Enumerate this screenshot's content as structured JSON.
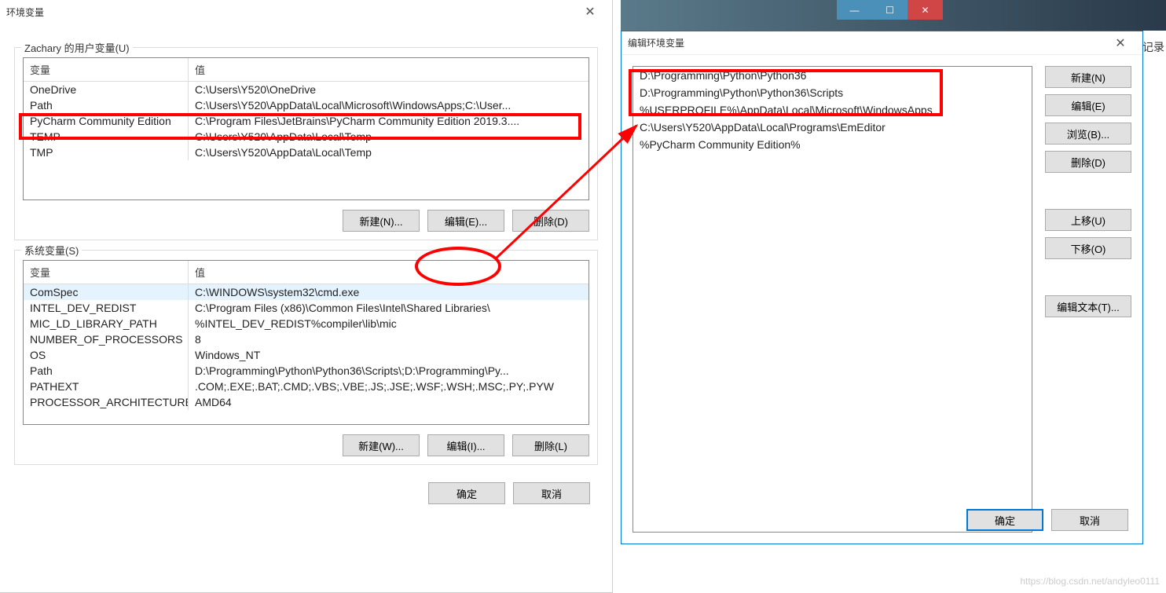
{
  "envDialog": {
    "title": "环境变量",
    "close": "✕",
    "userGroup": {
      "label": "Zachary 的用户变量(U)",
      "headers": {
        "name": "变量",
        "value": "值"
      },
      "rows": [
        {
          "name": "OneDrive",
          "value": "C:\\Users\\Y520\\OneDrive"
        },
        {
          "name": "Path",
          "value": "C:\\Users\\Y520\\AppData\\Local\\Microsoft\\WindowsApps;C:\\User..."
        },
        {
          "name": "PyCharm Community Edition",
          "value": "C:\\Program Files\\JetBrains\\PyCharm Community Edition 2019.3...."
        },
        {
          "name": "TEMP",
          "value": "C:\\Users\\Y520\\AppData\\Local\\Temp"
        },
        {
          "name": "TMP",
          "value": "C:\\Users\\Y520\\AppData\\Local\\Temp"
        }
      ],
      "buttons": {
        "new": "新建(N)...",
        "edit": "编辑(E)...",
        "delete": "删除(D)"
      }
    },
    "sysGroup": {
      "label": "系统变量(S)",
      "headers": {
        "name": "变量",
        "value": "值"
      },
      "rows": [
        {
          "name": "ComSpec",
          "value": "C:\\WINDOWS\\system32\\cmd.exe"
        },
        {
          "name": "INTEL_DEV_REDIST",
          "value": "C:\\Program Files (x86)\\Common Files\\Intel\\Shared Libraries\\"
        },
        {
          "name": "MIC_LD_LIBRARY_PATH",
          "value": "%INTEL_DEV_REDIST%compiler\\lib\\mic"
        },
        {
          "name": "NUMBER_OF_PROCESSORS",
          "value": "8"
        },
        {
          "name": "OS",
          "value": "Windows_NT"
        },
        {
          "name": "Path",
          "value": "D:\\Programming\\Python\\Python36\\Scripts\\;D:\\Programming\\Py..."
        },
        {
          "name": "PATHEXT",
          "value": ".COM;.EXE;.BAT;.CMD;.VBS;.VBE;.JS;.JSE;.WSF;.WSH;.MSC;.PY;.PYW"
        },
        {
          "name": "PROCESSOR_ARCHITECTURE",
          "value": "AMD64"
        }
      ],
      "buttons": {
        "new": "新建(W)...",
        "edit": "编辑(I)...",
        "delete": "删除(L)"
      }
    },
    "bottom": {
      "ok": "确定",
      "cancel": "取消"
    }
  },
  "editDialog": {
    "title": "编辑环境变量",
    "close": "✕",
    "paths": [
      "D:\\Programming\\Python\\Python36",
      "D:\\Programming\\Python\\Python36\\Scripts",
      "%USERPROFILE%\\AppData\\Local\\Microsoft\\WindowsApps",
      "C:\\Users\\Y520\\AppData\\Local\\Programs\\EmEditor",
      "%PyCharm Community Edition%"
    ],
    "buttons": {
      "new": "新建(N)",
      "edit": "编辑(E)",
      "browse": "浏览(B)...",
      "delete": "删除(D)",
      "up": "上移(U)",
      "down": "下移(O)",
      "editText": "编辑文本(T)...",
      "ok": "确定",
      "cancel": "取消"
    }
  },
  "watermark": "https://blog.csdn.net/andyleo0111",
  "sideText": "记录"
}
